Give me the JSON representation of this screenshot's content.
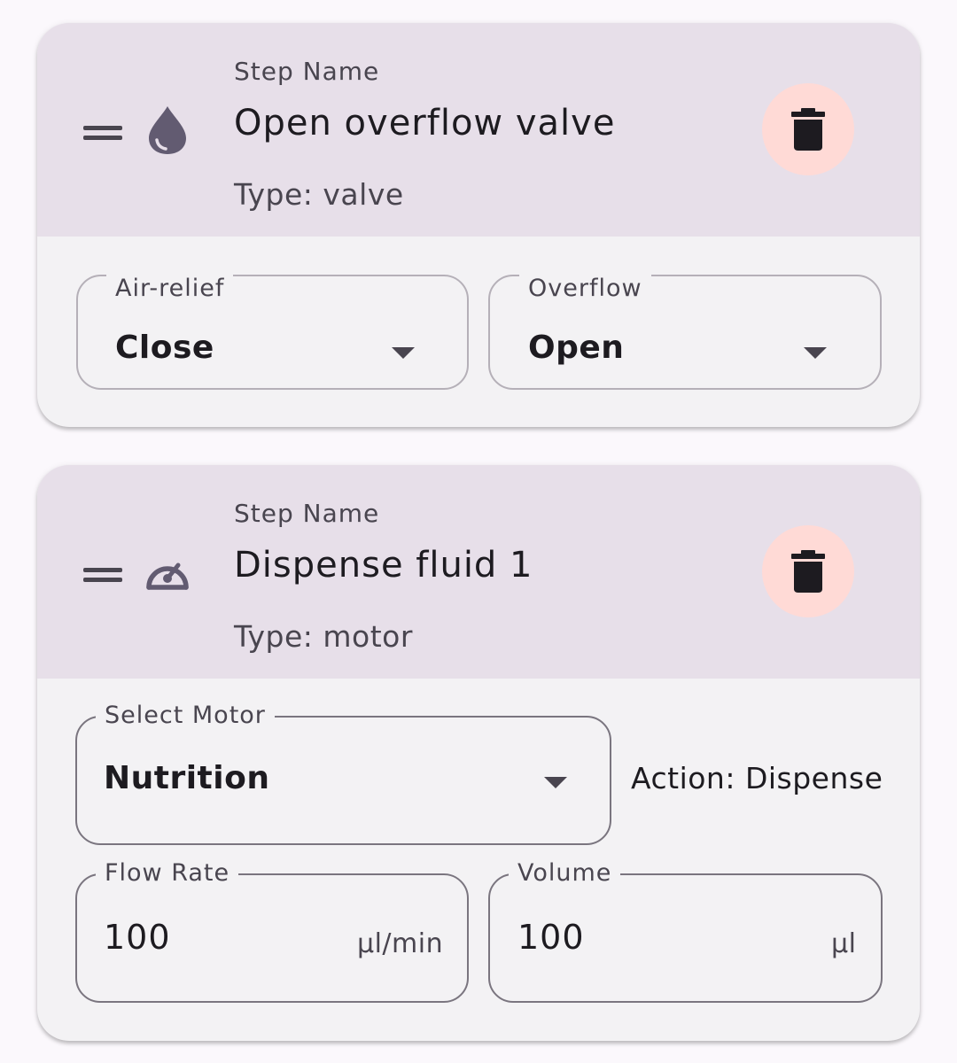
{
  "steps": [
    {
      "label": "Step Name",
      "name": "Open overflow valve",
      "type": "Type: valve",
      "type_icon": "water-drop-icon",
      "fields": [
        {
          "label": "Air-relief",
          "value": "Close"
        },
        {
          "label": "Overflow",
          "value": "Open"
        }
      ]
    },
    {
      "label": "Step Name",
      "name": "Dispense fluid 1",
      "type": "Type: motor",
      "type_icon": "speedometer-icon",
      "motor": {
        "label": "Select Motor",
        "value": "Nutrition"
      },
      "action": "Action: Dispense",
      "flow_rate": {
        "label": "Flow Rate",
        "value": "100",
        "unit": "µl/min"
      },
      "volume": {
        "label": "Volume",
        "value": "100",
        "unit": "µl"
      }
    }
  ],
  "colors": {
    "header_bg": "#e7dfe9",
    "card_bg": "#f3f2f4",
    "delete_bg": "#ffdad6",
    "icon": "#625b71"
  }
}
